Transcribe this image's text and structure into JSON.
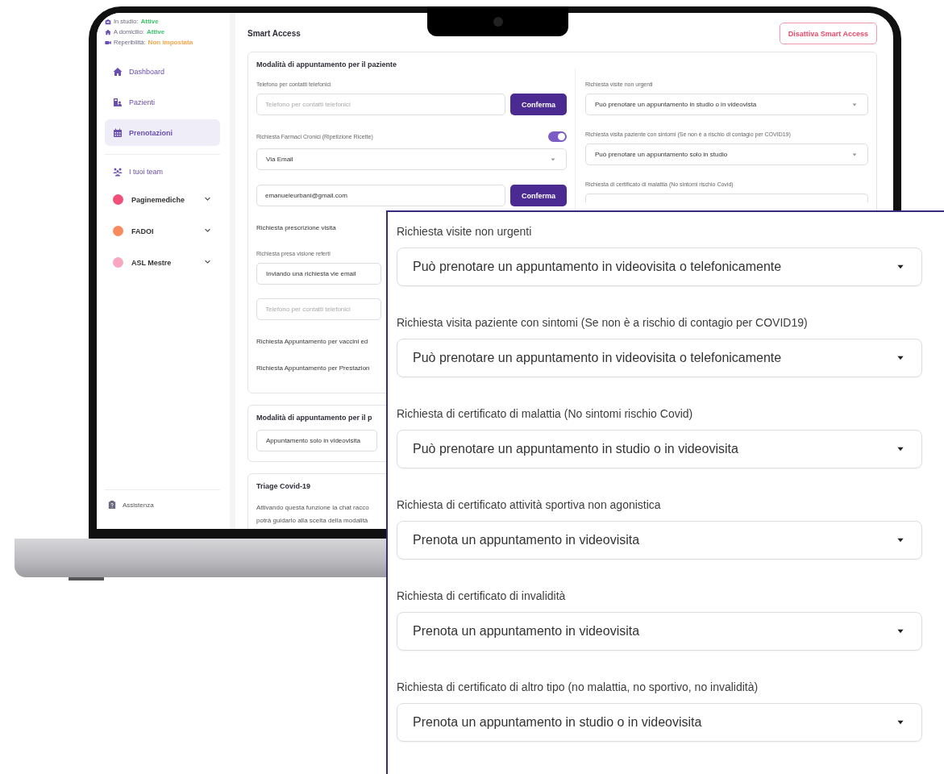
{
  "sidebar": {
    "status": [
      {
        "kind": "studio",
        "label": "In studio:",
        "value": "Attive",
        "color": "#3cc46a"
      },
      {
        "kind": "home",
        "label": "A domicilio:",
        "value": "Attive",
        "color": "#3cc46a"
      },
      {
        "kind": "video",
        "label": "Reperibilità:",
        "value": "Non impostata",
        "color": "#f5a54a"
      }
    ],
    "nav": [
      {
        "kind": "home",
        "label": "Dashboard",
        "selected": false
      },
      {
        "kind": "patients",
        "label": "Pazienti",
        "selected": false
      },
      {
        "kind": "calendar",
        "label": "Prenotazioni",
        "selected": true
      }
    ],
    "teams_heading": "I tuoi team",
    "teams": [
      {
        "name": "Paginemediche",
        "color": "#ef4f79"
      },
      {
        "name": "FADOI",
        "color": "#f98a5e"
      },
      {
        "name": "ASL Mestre",
        "color": "#f7a8c0"
      }
    ],
    "footer": "Assistenza"
  },
  "header": {
    "title": "Smart Access",
    "button": "Disattiva Smart Access"
  },
  "patient_card": {
    "title": "Modalità di appuntamento per il paziente",
    "left": [
      {
        "kind": "label",
        "text": "Telefono per contatti telefonici"
      },
      {
        "kind": "field",
        "placeholder": "Telefono per contatti telefonici",
        "button": "Conferma"
      },
      {
        "kind": "toggle",
        "text": "Richiesta Farmaci Cronici (Ripetizione Ricette)",
        "on": true
      },
      {
        "kind": "select",
        "value": "Via Email"
      },
      {
        "kind": "field",
        "value": "emanueleurbani@gmail.com",
        "button": "Conferma"
      },
      {
        "kind": "heading",
        "text": "Richiesta prescrizione visita"
      },
      {
        "kind": "label",
        "text": "Richiesta presa visione referti"
      },
      {
        "kind": "box",
        "value": "Inviando una richiesta vie email"
      },
      {
        "kind": "field",
        "placeholder": "Telefono per contatti telefonici"
      },
      {
        "kind": "heading",
        "text": "Richiesta Appuntamento per vaccini ed"
      },
      {
        "kind": "heading",
        "text": "Richiesta Appuntamento per Prestazion"
      }
    ],
    "right": [
      {
        "kind": "label",
        "text": "Richiesta visite non urgenti"
      },
      {
        "kind": "select",
        "value": "Può prenotare un appuntamento in studio o in videovista"
      },
      {
        "kind": "label",
        "text": "Richiesta visita paziente con sintomi (Se non è a rischio di contagio per COVID19)"
      },
      {
        "kind": "select",
        "value": "Può prenotare un appuntamento solo in studio"
      },
      {
        "kind": "label",
        "text": "Richiesta di certificato di malattia (No sintomi rischio Covid)"
      },
      {
        "kind": "box"
      }
    ]
  },
  "second_card": {
    "title": "Modalità di appuntamento per il p",
    "value": "Appuntamento solo in videovisita"
  },
  "triage_card": {
    "title": "Triage Covid-19",
    "lines": [
      "Attivando questa funzione la chat racco",
      "potrà guidarlo alla scelta della modalità"
    ]
  },
  "overlay": {
    "rows": [
      {
        "label": "Richiesta visite non urgenti",
        "value": "Può prenotare un appuntamento in videovisita o telefonicamente"
      },
      {
        "label": "Richiesta visita paziente con sintomi (Se non è a rischio di contagio per COVID19)",
        "value": "Può prenotare un appuntamento in videovisita o telefonicamente"
      },
      {
        "label": "Richiesta di certificato di malattia (No sintomi rischio Covid)",
        "value": "Può prenotare un appuntamento in studio o in videovisita"
      },
      {
        "label": "Richiesta di certificato attività sportiva non agonistica",
        "value": "Prenota un appuntamento in videovisita"
      },
      {
        "label": "Richiesta di certificato di invalidità",
        "value": "Prenota un appuntamento in videovisita"
      },
      {
        "label": "Richiesta di certificato di altro tipo (no malattia, no sportivo, no invalidità)",
        "value": "Prenota un appuntamento in studio o in videovisita"
      }
    ]
  }
}
